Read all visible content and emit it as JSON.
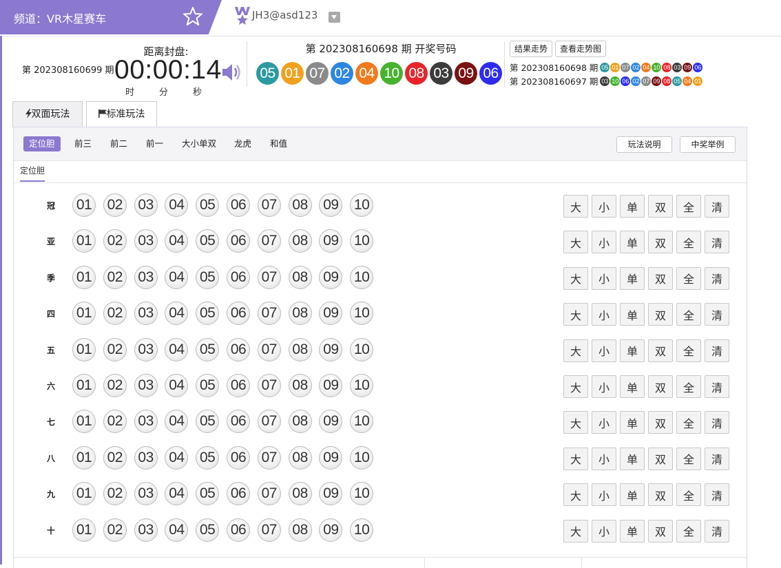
{
  "header": {
    "channel_label": "频道：VR木星赛车",
    "favorite_icon": "star-icon",
    "user_icon": "vip-badge-icon",
    "username": "JH3@asd123",
    "accent_color": "#8b78cf"
  },
  "countdown": {
    "current_period": "第 202308160699 期",
    "seal_label": "距离封盘:",
    "time": "00:00:14",
    "units": [
      "时",
      "分",
      "秒"
    ],
    "sound_icon": "speaker-icon"
  },
  "draw": {
    "title": "第 202308160698 期  开奖号码",
    "numbers": [
      {
        "n": "05",
        "color": "#2c9aa1"
      },
      {
        "n": "01",
        "color": "#f0a21e"
      },
      {
        "n": "07",
        "color": "#8a8a8a"
      },
      {
        "n": "02",
        "color": "#2e86e0"
      },
      {
        "n": "04",
        "color": "#f07a1c"
      },
      {
        "n": "10",
        "color": "#45b32c"
      },
      {
        "n": "08",
        "color": "#e8242a"
      },
      {
        "n": "03",
        "color": "#3b3b3b"
      },
      {
        "n": "09",
        "color": "#7a1212"
      },
      {
        "n": "06",
        "color": "#2d2cf0"
      }
    ],
    "buttons": {
      "trend": "结果走势",
      "chart": "查看走势图"
    },
    "history": [
      {
        "period": "第 202308160698 期",
        "numbers": [
          "05",
          "01",
          "07",
          "02",
          "04",
          "10",
          "08",
          "03",
          "09",
          "06"
        ]
      },
      {
        "period": "第 202308160697 期",
        "numbers": [
          "03",
          "10",
          "06",
          "02",
          "07",
          "09",
          "08",
          "05",
          "04",
          "01"
        ]
      }
    ],
    "number_colors": {
      "01": "#f0a21e",
      "02": "#2e86e0",
      "03": "#3b3b3b",
      "04": "#f07a1c",
      "05": "#2c9aa1",
      "06": "#2d2cf0",
      "07": "#8a8a8a",
      "08": "#e8242a",
      "09": "#7a1212",
      "10": "#45b32c"
    }
  },
  "tabs": [
    {
      "label": "双面玩法",
      "icon": "lightning-icon"
    },
    {
      "label": "标准玩法",
      "icon": "flag-icon"
    }
  ],
  "subnav": {
    "items": [
      "定位胆",
      "前三",
      "前二",
      "前一",
      "大小单双",
      "龙虎",
      "和值"
    ],
    "active": "定位胆",
    "help": "玩法说明",
    "example": "中奖举例",
    "sub_tab": "定位胆"
  },
  "board": {
    "rows": [
      "冠",
      "亚",
      "季",
      "四",
      "五",
      "六",
      "七",
      "八",
      "九",
      "十"
    ],
    "numbers": [
      "01",
      "02",
      "03",
      "04",
      "05",
      "06",
      "07",
      "08",
      "09",
      "10"
    ],
    "quick": [
      "大",
      "小",
      "单",
      "双",
      "全",
      "清"
    ]
  }
}
